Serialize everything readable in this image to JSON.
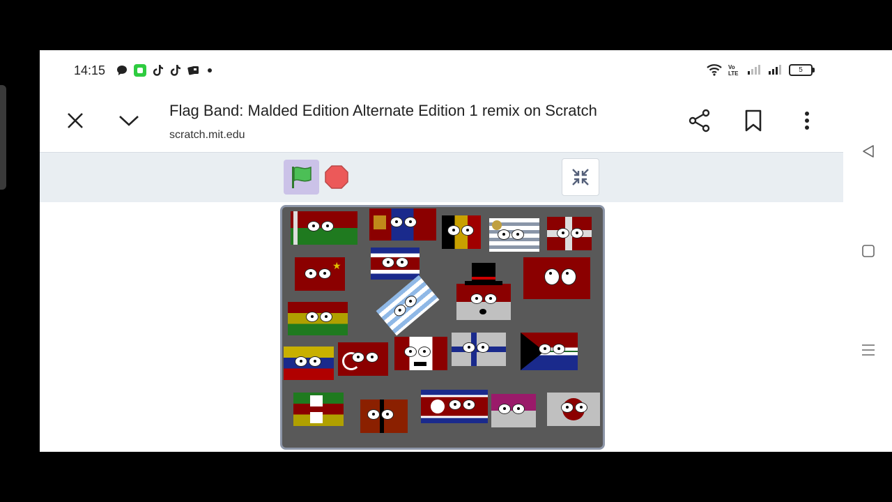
{
  "status_bar": {
    "time": "14:15",
    "battery_level": "5",
    "notification_icons": [
      "chat-bubble-icon",
      "green-app-icon",
      "tiktok-icon",
      "tiktok-icon",
      "cards-app-icon",
      "more-dot-icon"
    ],
    "system_icons": [
      "wifi-icon",
      "volte-icon",
      "signal-weak-icon",
      "signal-strong-icon",
      "battery-icon"
    ]
  },
  "toolbar": {
    "title": "Flag Band: Malded Edition Alternate Edition 1 remix on Scratch",
    "url": "scratch.mit.edu",
    "close_icon": "close-icon",
    "collapse_icon": "chevron-down-icon",
    "share_icon": "share-icon",
    "bookmark_icon": "bookmark-icon",
    "menu_icon": "more-vert-icon"
  },
  "player": {
    "green_flag_icon": "green-flag-icon",
    "stop_icon": "stop-sign-icon",
    "fullscreen_exit_icon": "exit-fullscreen-icon"
  },
  "stage": {
    "characters": [
      {
        "name": "flag-char-1",
        "colors": [
          "#8b0000",
          "#1f7a1f",
          "#ffffff"
        ]
      },
      {
        "name": "flag-char-2",
        "colors": [
          "#8b0000",
          "#1a2a8c",
          "#c08a1a"
        ]
      },
      {
        "name": "flag-char-3",
        "colors": [
          "#000000",
          "#c8a000",
          "#a00000"
        ]
      },
      {
        "name": "flag-char-4",
        "colors": [
          "#8a96a8",
          "#ffffff",
          "#c0a040"
        ]
      },
      {
        "name": "flag-char-5",
        "colors": [
          "#8b0000",
          "#ffffff",
          "#8b0000"
        ]
      },
      {
        "name": "flag-char-6",
        "colors": [
          "#8b0000",
          "#e0c000"
        ]
      },
      {
        "name": "flag-char-7",
        "colors": [
          "#1a2a8c",
          "#ffffff",
          "#8b0000"
        ]
      },
      {
        "name": "flag-char-8",
        "colors": [
          "#8b0000"
        ]
      },
      {
        "name": "flag-char-9",
        "colors": [
          "#8fb8e6",
          "#ffffff"
        ]
      },
      {
        "name": "flag-char-10",
        "colors": [
          "#8b0000",
          "#c0c0c0",
          "#000000"
        ]
      },
      {
        "name": "flag-char-11",
        "colors": [
          "#8b0000",
          "#b0a000",
          "#1f7a1f"
        ]
      },
      {
        "name": "flag-char-12",
        "colors": [
          "#c8b000",
          "#1a2a8c",
          "#b00000"
        ]
      },
      {
        "name": "flag-char-13",
        "colors": [
          "#8b0000",
          "#ffffff"
        ]
      },
      {
        "name": "flag-char-14",
        "colors": [
          "#8b0000",
          "#ffffff",
          "#000000"
        ]
      },
      {
        "name": "flag-char-15",
        "colors": [
          "#c0c0c0",
          "#1a2a8c"
        ]
      },
      {
        "name": "flag-char-16",
        "colors": [
          "#1f6a2a",
          "#e0c000",
          "#8b0000",
          "#1a2a8c"
        ]
      },
      {
        "name": "flag-char-17",
        "colors": [
          "#1f7a1f",
          "#8b0000",
          "#b0a000"
        ]
      },
      {
        "name": "flag-char-18",
        "colors": [
          "#8b2000",
          "#000000"
        ]
      },
      {
        "name": "flag-char-19",
        "colors": [
          "#1a2a8c",
          "#8b0000",
          "#ffffff"
        ]
      },
      {
        "name": "flag-char-20",
        "colors": [
          "#9a1a6a",
          "#c0c0c0"
        ]
      },
      {
        "name": "flag-char-21",
        "colors": [
          "#c0c0c0",
          "#8b0000"
        ]
      }
    ]
  }
}
